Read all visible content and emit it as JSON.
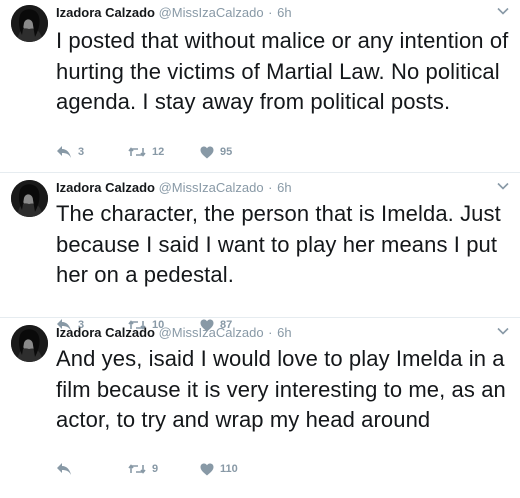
{
  "tweets": [
    {
      "name": "Izadora Calzado",
      "handle": "@MissIzaCalzado",
      "dot": "·",
      "time": "6h",
      "text": "I posted that without malice or any intention of hurting the victims of Martial Law. No political agenda. I stay away from political posts.",
      "replies": "3",
      "retweets": "12",
      "likes": "95"
    },
    {
      "name": "Izadora Calzado",
      "handle": "@MissIzaCalzado",
      "dot": "·",
      "time": "6h",
      "text": "The character, the person that is Imelda. Just because I said I want to play her means I put her on a pedestal.",
      "replies": "3",
      "retweets": "10",
      "likes": "87"
    },
    {
      "name": "Izadora Calzado",
      "handle": "@MissIzaCalzado",
      "dot": "·",
      "time": "6h",
      "text": "And yes, isaid I would love to play Imelda in a film because it is very interesting to me, as an actor, to try and wrap my head around",
      "replies": "",
      "retweets": "9",
      "likes": "110"
    }
  ],
  "icons": {
    "reply": "reply-icon",
    "retweet": "retweet-icon",
    "like": "heart-icon",
    "more": "chevron-down-icon"
  },
  "colors": {
    "name": "#14171a",
    "meta": "#8899a6",
    "divider": "#e6ecf0"
  }
}
